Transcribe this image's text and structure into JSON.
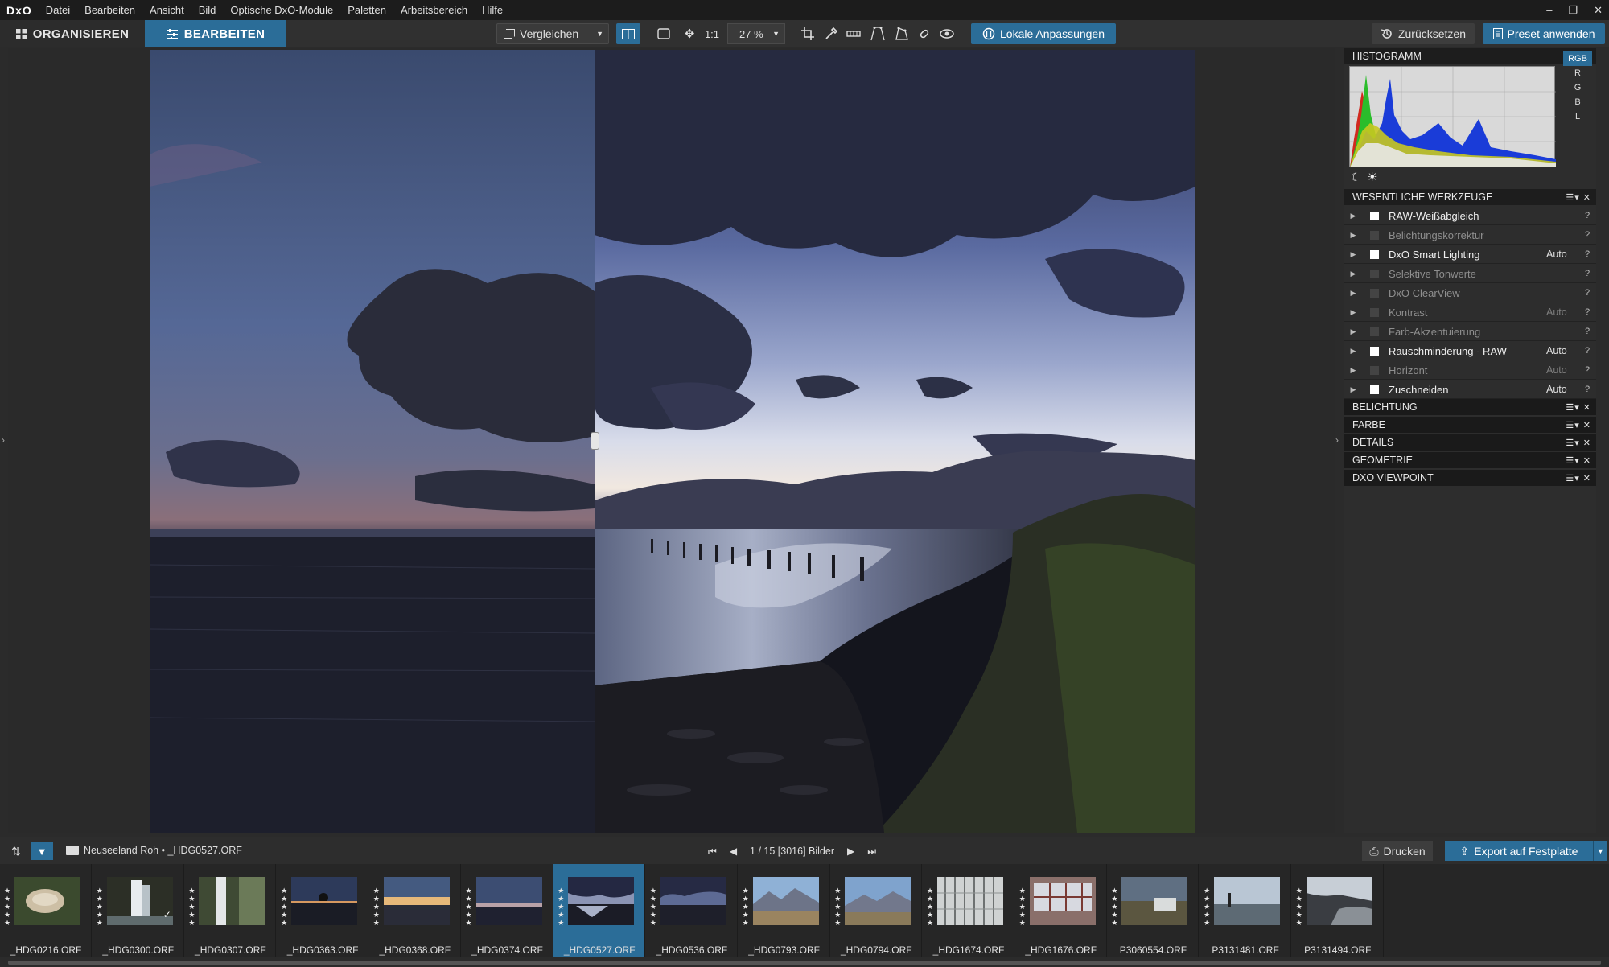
{
  "app": {
    "logo": "DxO"
  },
  "menu": [
    "Datei",
    "Bearbeiten",
    "Ansicht",
    "Bild",
    "Optische DxO-Module",
    "Paletten",
    "Arbeitsbereich",
    "Hilfe"
  ],
  "window_controls": {
    "minimize": "–",
    "restore": "❐",
    "close": "✕"
  },
  "tabs": {
    "organize": "ORGANISIEREN",
    "edit": "BEARBEITEN"
  },
  "toolbar": {
    "compare_label": "Vergleichen",
    "zoom_1to1": "1:1",
    "zoom_value": "27 %",
    "local_adjustments": "Lokale Anpassungen",
    "reset": "Zurücksetzen",
    "apply_preset": "Preset anwenden"
  },
  "histogram": {
    "title": "HISTOGRAMM",
    "channels": [
      "RGB",
      "R",
      "G",
      "B",
      "L"
    ],
    "selected_channel": "RGB"
  },
  "essential_tools": {
    "title": "WESENTLICHE WERKZEUGE",
    "items": [
      {
        "name": "RAW-Weißabgleich",
        "value": "",
        "state": "active"
      },
      {
        "name": "Belichtungskorrektur",
        "value": "",
        "state": "inactive"
      },
      {
        "name": "DxO Smart Lighting",
        "value": "Auto",
        "state": "active"
      },
      {
        "name": "Selektive Tonwerte",
        "value": "",
        "state": "inactive"
      },
      {
        "name": "DxO ClearView",
        "value": "",
        "state": "inactive"
      },
      {
        "name": "Kontrast",
        "value": "Auto",
        "state": "inactive"
      },
      {
        "name": "Farb-Akzentuierung",
        "value": "",
        "state": "inactive"
      },
      {
        "name": "Rauschminderung - RAW",
        "value": "Auto",
        "state": "active"
      },
      {
        "name": "Horizont",
        "value": "Auto",
        "state": "inactive"
      },
      {
        "name": "Zuschneiden",
        "value": "Auto",
        "state": "active"
      }
    ],
    "help": "?"
  },
  "categories": [
    "BELICHTUNG",
    "FARBE",
    "DETAILS",
    "GEOMETRIE",
    "DXO VIEWPOINT"
  ],
  "palette_controls": "☰▾ ✕",
  "filmbar": {
    "folder": "Neuseeland Roh",
    "separator": "•",
    "current_file": "_HDG0527.ORF",
    "count": "1 / 15 [3016] Bilder",
    "print": "Drucken",
    "export": "Export auf Festplatte",
    "more": "• • •"
  },
  "thumbnails": [
    {
      "label": "_HDG0216.ORF",
      "selected": false,
      "scene": "fungus"
    },
    {
      "label": "_HDG0300.ORF",
      "selected": false,
      "scene": "waterfall",
      "checked": true
    },
    {
      "label": "_HDG0307.ORF",
      "selected": false,
      "scene": "waterfall2"
    },
    {
      "label": "_HDG0363.ORF",
      "selected": false,
      "scene": "dusk-hand"
    },
    {
      "label": "_HDG0368.ORF",
      "selected": false,
      "scene": "sunset"
    },
    {
      "label": "_HDG0374.ORF",
      "selected": false,
      "scene": "dusk"
    },
    {
      "label": "_HDG0527.ORF",
      "selected": true,
      "scene": "lake"
    },
    {
      "label": "_HDG0536.ORF",
      "selected": false,
      "scene": "lake2"
    },
    {
      "label": "_HDG0793.ORF",
      "selected": false,
      "scene": "mountains"
    },
    {
      "label": "_HDG0794.ORF",
      "selected": false,
      "scene": "mountains2"
    },
    {
      "label": "_HDG1674.ORF",
      "selected": false,
      "scene": "architecture"
    },
    {
      "label": "_HDG1676.ORF",
      "selected": false,
      "scene": "interior"
    },
    {
      "label": "P3060554.ORF",
      "selected": false,
      "scene": "van"
    },
    {
      "label": "P3131481.ORF",
      "selected": false,
      "scene": "coast"
    },
    {
      "label": "P3131494.ORF",
      "selected": false,
      "scene": "coast2"
    }
  ],
  "colors": {
    "accent": "#2b6d98",
    "panel": "#2d2d2d",
    "header": "#1d1d1d"
  }
}
